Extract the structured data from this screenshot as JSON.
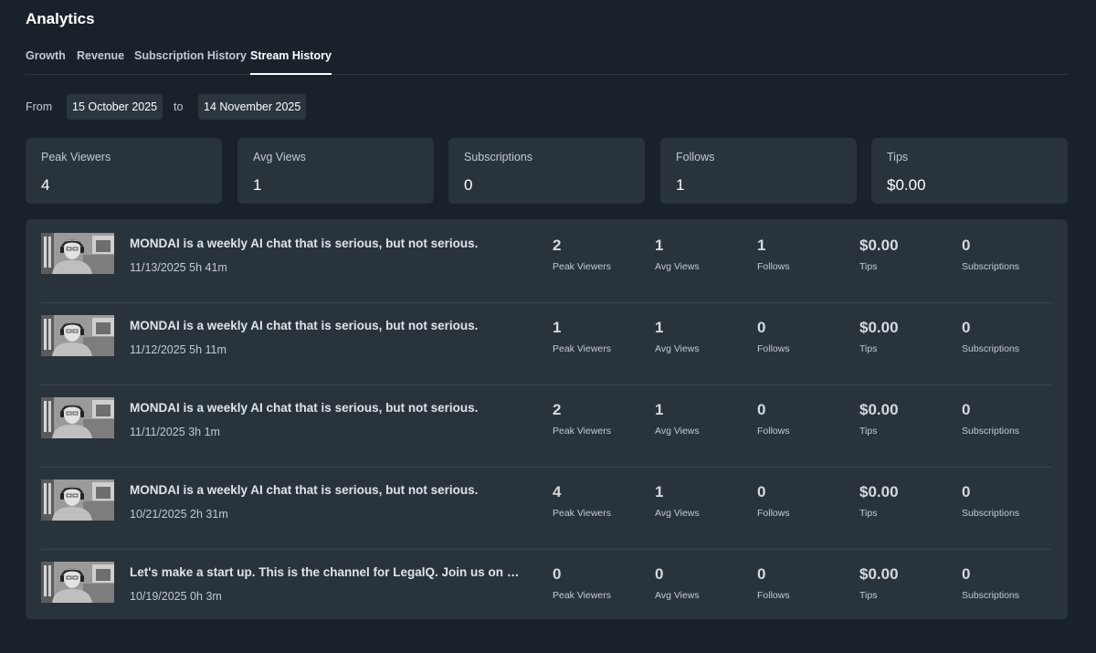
{
  "header": {
    "title": "Analytics"
  },
  "tabs": [
    {
      "label": "Growth",
      "active": false
    },
    {
      "label": "Revenue",
      "active": false
    },
    {
      "label": "Subscription History",
      "active": false
    },
    {
      "label": "Stream History",
      "active": true
    }
  ],
  "range": {
    "from_label": "From",
    "from_value": "15 October 2025",
    "to_label": "to",
    "to_value": "14 November 2025"
  },
  "summary": [
    {
      "label": "Peak Viewers",
      "value": "4"
    },
    {
      "label": "Avg Views",
      "value": "1"
    },
    {
      "label": "Subscriptions",
      "value": "0"
    },
    {
      "label": "Follows",
      "value": "1"
    },
    {
      "label": "Tips",
      "value": "$0.00"
    }
  ],
  "metric_labels": {
    "peak": "Peak Viewers",
    "avg": "Avg Views",
    "follows": "Follows",
    "tips": "Tips",
    "subs": "Subscriptions"
  },
  "streams": [
    {
      "title": "MONDAI is a weekly AI chat that is serious, but not serious.",
      "date": "11/13/2025",
      "duration": "5h 41m",
      "peak": "2",
      "avg": "1",
      "follows": "1",
      "tips": "$0.00",
      "subs": "0"
    },
    {
      "title": "MONDAI is a weekly AI chat that is serious, but not serious.",
      "date": "11/12/2025",
      "duration": "5h 11m",
      "peak": "1",
      "avg": "1",
      "follows": "0",
      "tips": "$0.00",
      "subs": "0"
    },
    {
      "title": "MONDAI is a weekly AI chat that is serious, but not serious.",
      "date": "11/11/2025",
      "duration": "3h 1m",
      "peak": "2",
      "avg": "1",
      "follows": "0",
      "tips": "$0.00",
      "subs": "0"
    },
    {
      "title": "MONDAI is a weekly AI chat that is serious, but not serious.",
      "date": "10/21/2025",
      "duration": "2h 31m",
      "peak": "4",
      "avg": "1",
      "follows": "0",
      "tips": "$0.00",
      "subs": "0"
    },
    {
      "title": "Let's make a start up. This is the channel for LegalQ. Join us on this journey.",
      "date": "10/19/2025",
      "duration": "0h 3m",
      "peak": "0",
      "avg": "0",
      "follows": "0",
      "tips": "$0.00",
      "subs": "0"
    }
  ]
}
